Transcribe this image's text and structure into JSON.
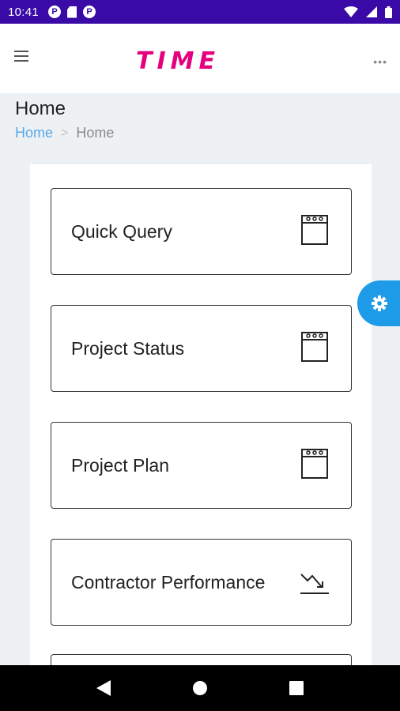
{
  "status_bar": {
    "time": "10:41",
    "left_icons": [
      "p-notification-icon",
      "sd-card-icon",
      "p-notification-icon"
    ],
    "right_icons": [
      "wifi-icon",
      "signal-icon",
      "battery-icon"
    ]
  },
  "header": {
    "logo_text": "TIME",
    "brand_color": "#e5007e"
  },
  "page": {
    "title": "Home",
    "breadcrumb": {
      "link": "Home",
      "separator": ">",
      "current": "Home"
    }
  },
  "menu": {
    "items": [
      {
        "label": "Quick Query",
        "icon": "notepad-icon"
      },
      {
        "label": "Project Status",
        "icon": "notepad-icon"
      },
      {
        "label": "Project Plan",
        "icon": "notepad-icon"
      },
      {
        "label": "Contractor Performance",
        "icon": "trend-down-icon"
      }
    ]
  },
  "colors": {
    "status_bar": "#3a0aa6",
    "accent": "#1e9be8",
    "breadcrumb_link": "#5aa7e6"
  }
}
